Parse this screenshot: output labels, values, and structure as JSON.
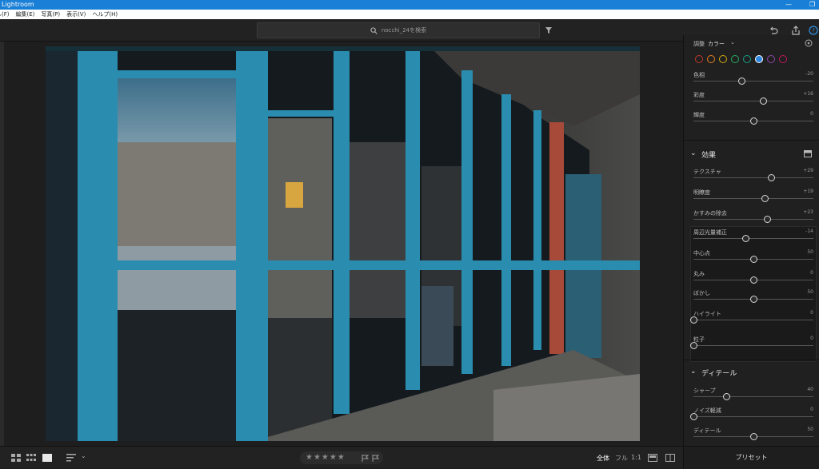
{
  "window": {
    "title": "Lightroom"
  },
  "menu": [
    "ファイル(F)",
    "編集(E)",
    "写真(P)",
    "表示(V)",
    "ヘルプ(H)"
  ],
  "search": {
    "text": "nocchi_24を検索"
  },
  "color_panel": {
    "mode_label": "調整",
    "mode_value": "カラー",
    "dot_colors": [
      "#c0392b",
      "#e67e22",
      "#d4ac0d",
      "#27ae60",
      "#16a085",
      "#2e86de",
      "#8e44ad",
      "#c2185b"
    ],
    "selected_dot": 5,
    "sliders": [
      {
        "label": "色相",
        "value": "-20",
        "pos": 0.4
      },
      {
        "label": "彩度",
        "value": "+16",
        "pos": 0.58
      },
      {
        "label": "輝度",
        "value": "0",
        "pos": 0.5
      }
    ]
  },
  "effects": {
    "header": "効果",
    "sliders": [
      {
        "label": "テクスチャ",
        "value": "+29",
        "pos": 0.645
      },
      {
        "label": "明瞭度",
        "value": "+19",
        "pos": 0.595
      },
      {
        "label": "かすみの除去",
        "value": "+23",
        "pos": 0.615
      }
    ],
    "vignette": {
      "label": "周辺光量補正",
      "value": "-14",
      "pos": 0.43,
      "sub_sliders": [
        {
          "label": "中心点",
          "value": "50",
          "pos": 0.5
        },
        {
          "label": "丸み",
          "value": "0",
          "pos": 0.5
        },
        {
          "label": "ぼかし",
          "value": "50",
          "pos": 0.5
        },
        {
          "label": "ハイライト",
          "value": "0",
          "pos": 0.0
        }
      ]
    },
    "grain": {
      "label": "粒子",
      "value": "0",
      "pos": 0.0
    }
  },
  "detail": {
    "header": "ディテール",
    "sliders": [
      {
        "label": "シャープ",
        "value": "40",
        "pos": 0.27
      },
      {
        "label": "ノイズ軽減",
        "value": "0",
        "pos": 0.0
      },
      {
        "label": "ディテール",
        "value": "50",
        "pos": 0.5
      }
    ]
  },
  "bottom": {
    "stars": "★★★★★",
    "view_all": "全体",
    "view_full": "フル",
    "view_1to1": "1:1",
    "presets": "プリセット"
  }
}
